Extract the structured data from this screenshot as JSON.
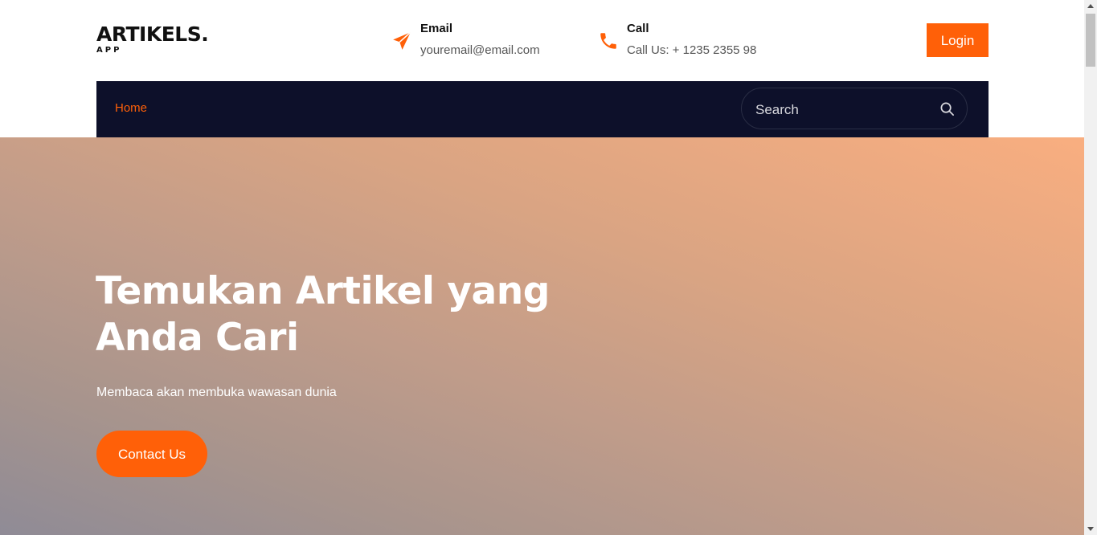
{
  "brand": {
    "name": "ARTIKELS.",
    "sub": "APP"
  },
  "contact": {
    "email_title": "Email",
    "email_value": "youremail@email.com",
    "call_title": "Call",
    "call_value": "Call Us: + 1235 2355 98",
    "email_icon": "paper-plane-icon",
    "call_icon": "phone-icon"
  },
  "header": {
    "login_label": "Login"
  },
  "nav": {
    "home_label": "Home",
    "search_placeholder": "Search",
    "search_icon": "search-icon"
  },
  "hero": {
    "title": "Temukan Artikel yang Anda Cari",
    "subtitle": "Membaca akan membuka wawasan dunia",
    "cta_label": "Contact Us"
  },
  "colors": {
    "accent": "#ff6008",
    "nav_bg": "#0d102a",
    "hero_gradient_start": "#8f8b96",
    "hero_gradient_end": "#f9ae80"
  }
}
